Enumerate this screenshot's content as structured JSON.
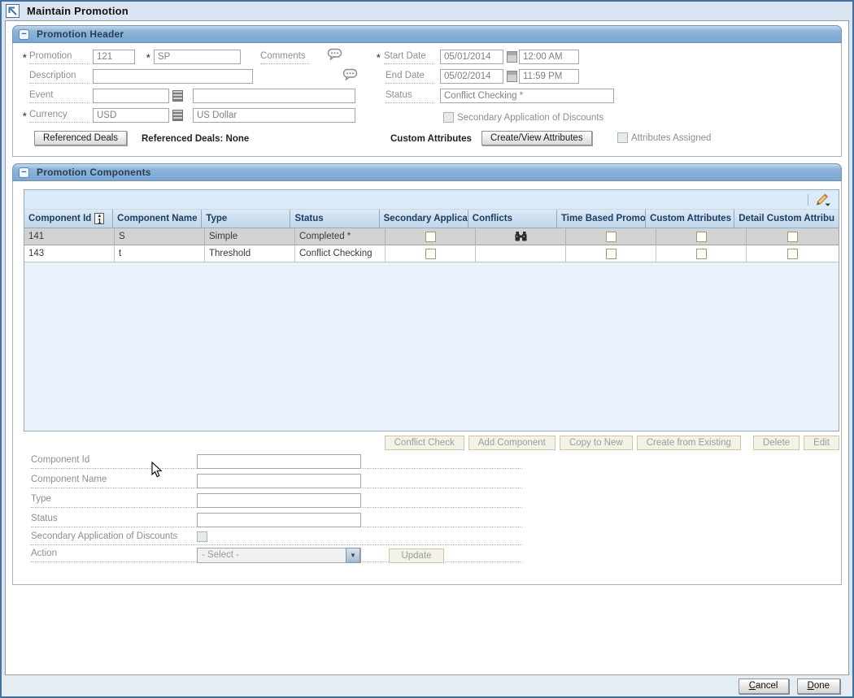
{
  "window": {
    "title": "Maintain Promotion"
  },
  "promotion_header": {
    "title": "Promotion Header",
    "promotion_label": "Promotion",
    "promotion_id": "121",
    "promotion_name": "SP",
    "comments_label": "Comments",
    "description_label": "Description",
    "description_value": "",
    "event_label": "Event",
    "event_id": "",
    "event_name": "",
    "currency_label": "Currency",
    "currency_code": "USD",
    "currency_name": "US Dollar",
    "start_date_label": "Start Date",
    "start_date": "05/01/2014",
    "start_time": "12:00 AM",
    "end_date_label": "End Date",
    "end_date": "05/02/2014",
    "end_time": "11:59 PM",
    "status_label": "Status",
    "status_value": "Conflict Checking *",
    "secondary_discounts_label": "Secondary Application of Discounts",
    "referenced_deals_button": "Referenced Deals",
    "referenced_deals_status": "Referenced Deals: None",
    "custom_attributes_label": "Custom Attributes",
    "create_view_attributes_button": "Create/View Attributes",
    "attributes_assigned_label": "Attributes Assigned"
  },
  "promotion_components": {
    "title": "Promotion Components",
    "table": {
      "columns": [
        "Component Id",
        "Component Name",
        "Type",
        "Status",
        "Secondary Applicatio",
        "Conflicts",
        "Time Based Promotio",
        "Custom Attributes",
        "Detail Custom Attribu"
      ],
      "rows": [
        {
          "component_id": "141",
          "component_name": "S",
          "type": "Simple",
          "status": "Completed *"
        },
        {
          "component_id": "143",
          "component_name": "t",
          "type": "Threshold",
          "status": "Conflict Checking"
        }
      ]
    },
    "buttons": {
      "conflict_check": "Conflict Check",
      "add_component": "Add Component",
      "copy_to_new": "Copy to New",
      "create_from_existing": "Create from Existing",
      "delete": "Delete",
      "edit": "Edit"
    },
    "form": {
      "component_id_label": "Component Id",
      "component_name_label": "Component Name",
      "type_label": "Type",
      "status_label": "Status",
      "secondary_discounts_label": "Secondary Application of Discounts",
      "action_label": "Action",
      "action_value": "- Select -",
      "update_button": "Update"
    }
  },
  "footer": {
    "cancel": "Cancel",
    "done": "Done"
  }
}
